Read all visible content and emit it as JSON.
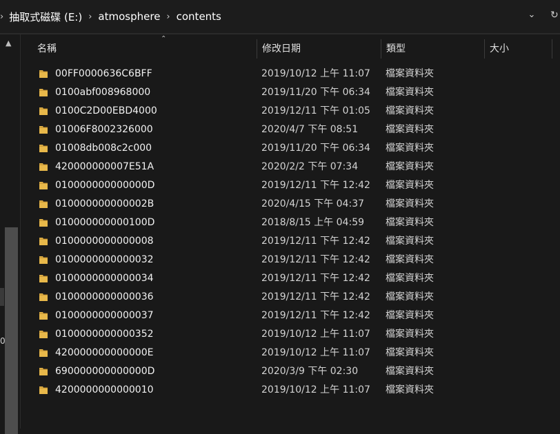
{
  "breadcrumb": [
    "抽取式磁碟 (E:)",
    "atmosphere",
    "contents"
  ],
  "columns": {
    "name": "名稱",
    "modified": "修改日期",
    "type": "類型",
    "size": "大小"
  },
  "files": [
    {
      "name": "00FF0000636C6BFF",
      "modified": "2019/10/12 上午 11:07",
      "type": "檔案資料夾"
    },
    {
      "name": "0100abf008968000",
      "modified": "2019/11/20 下午 06:34",
      "type": "檔案資料夾"
    },
    {
      "name": "0100C2D00EBD4000",
      "modified": "2019/12/11 下午 01:05",
      "type": "檔案資料夾"
    },
    {
      "name": "01006F8002326000",
      "modified": "2020/4/7 下午 08:51",
      "type": "檔案資料夾"
    },
    {
      "name": "01008db008c2c000",
      "modified": "2019/11/20 下午 06:34",
      "type": "檔案資料夾"
    },
    {
      "name": "420000000007E51A",
      "modified": "2020/2/2 下午 07:34",
      "type": "檔案資料夾"
    },
    {
      "name": "010000000000000D",
      "modified": "2019/12/11 下午 12:42",
      "type": "檔案資料夾"
    },
    {
      "name": "010000000000002B",
      "modified": "2020/4/15 下午 04:37",
      "type": "檔案資料夾"
    },
    {
      "name": "010000000000100D",
      "modified": "2018/8/15 上午 04:59",
      "type": "檔案資料夾"
    },
    {
      "name": "0100000000000008",
      "modified": "2019/12/11 下午 12:42",
      "type": "檔案資料夾"
    },
    {
      "name": "0100000000000032",
      "modified": "2019/12/11 下午 12:42",
      "type": "檔案資料夾"
    },
    {
      "name": "0100000000000034",
      "modified": "2019/12/11 下午 12:42",
      "type": "檔案資料夾"
    },
    {
      "name": "0100000000000036",
      "modified": "2019/12/11 下午 12:42",
      "type": "檔案資料夾"
    },
    {
      "name": "0100000000000037",
      "modified": "2019/12/11 下午 12:42",
      "type": "檔案資料夾"
    },
    {
      "name": "0100000000000352",
      "modified": "2019/10/12 上午 11:07",
      "type": "檔案資料夾"
    },
    {
      "name": "420000000000000E",
      "modified": "2019/10/12 上午 11:07",
      "type": "檔案資料夾"
    },
    {
      "name": "690000000000000D",
      "modified": "2020/3/9 下午 02:30",
      "type": "檔案資料夾"
    },
    {
      "name": "4200000000000010",
      "modified": "2019/10/12 上午 11:07",
      "type": "檔案資料夾"
    }
  ],
  "nav": {
    "partial_label": "0"
  },
  "icons": {
    "breadcrumb_separator": "chevron-right-icon",
    "address_dropdown": "chevron-down-icon",
    "refresh": "refresh-icon",
    "folder": "folder-icon",
    "sort": "sort-ascending-icon"
  },
  "colors": {
    "folder": "#e8b84a",
    "background": "#191919"
  }
}
